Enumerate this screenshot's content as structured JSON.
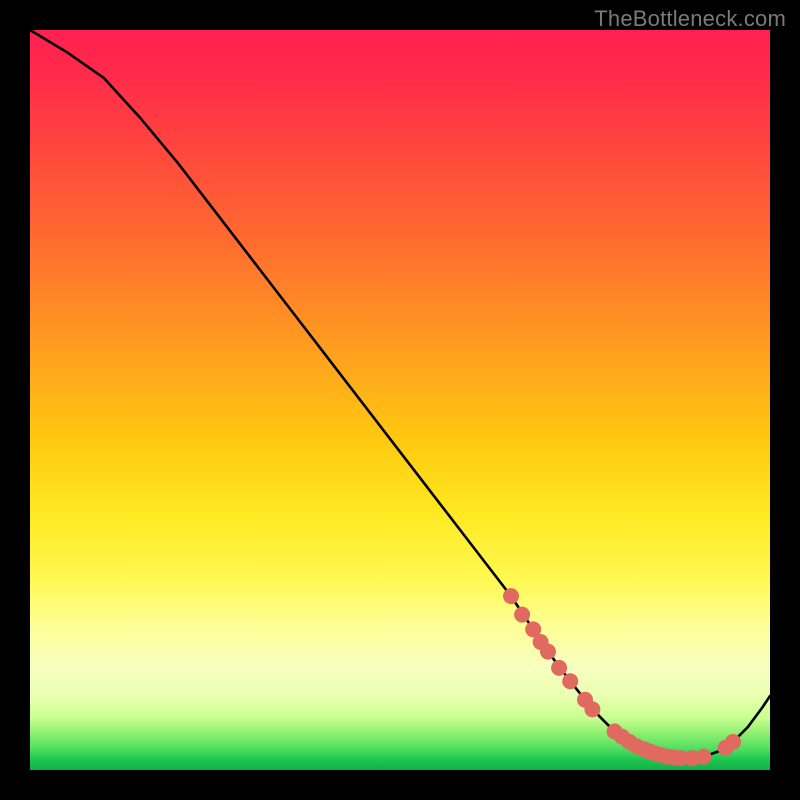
{
  "watermark": "TheBottleneck.com",
  "chart_data": {
    "type": "line",
    "title": "",
    "xlabel": "",
    "ylabel": "",
    "xlim": [
      0,
      100
    ],
    "ylim": [
      0,
      100
    ],
    "grid": false,
    "legend": false,
    "series": [
      {
        "name": "bottleneck-curve",
        "x": [
          0,
          5,
          10,
          15,
          20,
          25,
          30,
          35,
          40,
          45,
          50,
          55,
          60,
          65,
          68,
          70,
          73,
          75,
          77,
          79,
          81,
          83,
          85,
          87,
          89,
          91,
          93,
          95,
          97,
          99,
          100
        ],
        "y": [
          100,
          97,
          93.5,
          88,
          82,
          75.5,
          69,
          62.5,
          56,
          49.5,
          43,
          36.5,
          30,
          23.5,
          19,
          16,
          12,
          9.5,
          7.2,
          5.2,
          3.8,
          2.8,
          2.1,
          1.7,
          1.6,
          1.8,
          2.5,
          3.8,
          5.8,
          8.5,
          10
        ]
      }
    ],
    "markers": {
      "name": "highlight-points",
      "color": "#e06a60",
      "radius_px": 8,
      "points": [
        {
          "x": 65.0,
          "y": 23.5
        },
        {
          "x": 66.5,
          "y": 21.0
        },
        {
          "x": 68.0,
          "y": 19.0
        },
        {
          "x": 69.0,
          "y": 17.3
        },
        {
          "x": 70.0,
          "y": 16.0
        },
        {
          "x": 71.5,
          "y": 13.8
        },
        {
          "x": 73.0,
          "y": 12.0
        },
        {
          "x": 75.0,
          "y": 9.5
        },
        {
          "x": 76.0,
          "y": 8.2
        },
        {
          "x": 79.0,
          "y": 5.2
        },
        {
          "x": 80.0,
          "y": 4.5
        },
        {
          "x": 81.0,
          "y": 3.8
        },
        {
          "x": 82.0,
          "y": 3.2
        },
        {
          "x": 83.0,
          "y": 2.8
        },
        {
          "x": 83.8,
          "y": 2.5
        },
        {
          "x": 84.6,
          "y": 2.2
        },
        {
          "x": 85.4,
          "y": 2.0
        },
        {
          "x": 86.2,
          "y": 1.8
        },
        {
          "x": 87.0,
          "y": 1.7
        },
        {
          "x": 88.0,
          "y": 1.6
        },
        {
          "x": 89.5,
          "y": 1.6
        },
        {
          "x": 91.0,
          "y": 1.8
        },
        {
          "x": 94.0,
          "y": 3.0
        },
        {
          "x": 95.0,
          "y": 3.8
        }
      ]
    }
  }
}
